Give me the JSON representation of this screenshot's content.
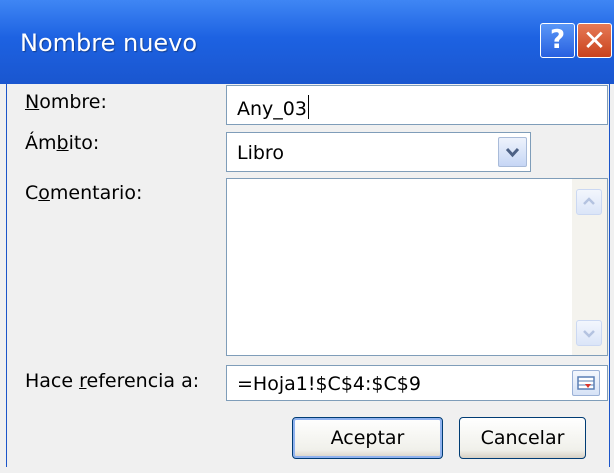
{
  "dialog": {
    "title": "Nombre nuevo",
    "help_button": "?",
    "close_button": "✕"
  },
  "fields": {
    "name": {
      "label_accel": "N",
      "label_rest": "ombre:",
      "value": "Any_03"
    },
    "scope": {
      "label_pre": "Ám",
      "label_accel": "b",
      "label_post": "ito:",
      "value": "Libro"
    },
    "comment": {
      "label_pre": "C",
      "label_accel": "o",
      "label_post": "mentario:",
      "value": ""
    },
    "refers_to": {
      "label_pre": "Hace ",
      "label_accel": "r",
      "label_post": "eferencia a:",
      "value": "=Hoja1!$C$4:$C$9"
    }
  },
  "buttons": {
    "ok": "Aceptar",
    "cancel": "Cancelar"
  },
  "colors": {
    "titlebar": "#1d62e2",
    "window_bg": "#f0f0f0"
  }
}
